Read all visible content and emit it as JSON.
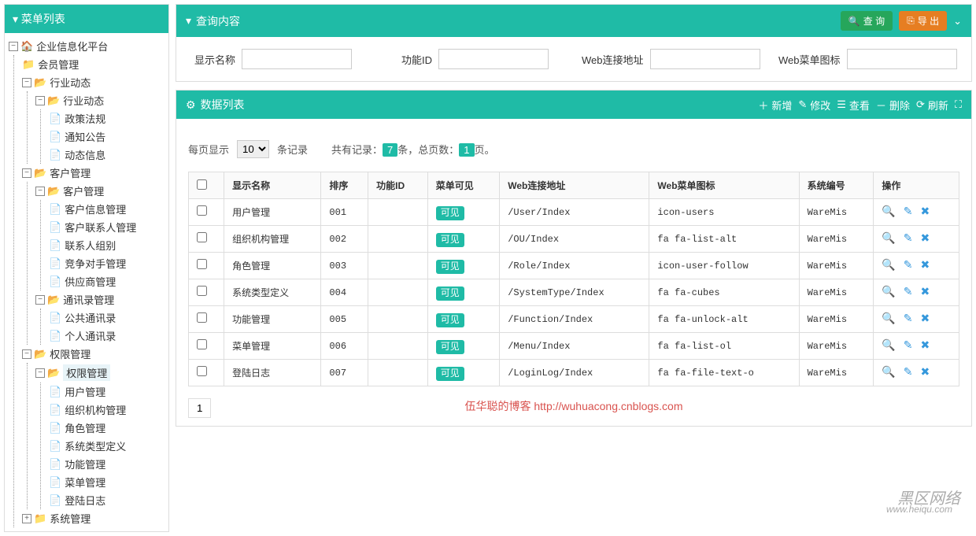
{
  "sidebar": {
    "title": "菜单列表",
    "tree": {
      "root": "企业信息化平台",
      "n0": "会员管理",
      "n1": "行业动态",
      "n1_0": "行业动态",
      "n1_0_0": "政策法规",
      "n1_0_1": "通知公告",
      "n1_0_2": "动态信息",
      "n2": "客户管理",
      "n2_0": "客户管理",
      "n2_0_0": "客户信息管理",
      "n2_0_1": "客户联系人管理",
      "n2_0_2": "联系人组别",
      "n2_0_3": "竞争对手管理",
      "n2_0_4": "供应商管理",
      "n2_1": "通讯录管理",
      "n2_1_0": "公共通讯录",
      "n2_1_1": "个人通讯录",
      "n3": "权限管理",
      "n3_0": "权限管理",
      "n3_0_0": "用户管理",
      "n3_0_1": "组织机构管理",
      "n3_0_2": "角色管理",
      "n3_0_3": "系统类型定义",
      "n3_0_4": "功能管理",
      "n3_0_5": "菜单管理",
      "n3_0_6": "登陆日志",
      "n4": "系统管理"
    }
  },
  "query": {
    "title": "查询内容",
    "search_btn": "查 询",
    "export_btn": "导 出",
    "f1": "显示名称",
    "f2": "功能ID",
    "f3": "Web连接地址",
    "f4": "Web菜单图标"
  },
  "datalist": {
    "title": "数据列表",
    "add": "新增",
    "edit": "修改",
    "view": "查看",
    "delete": "删除",
    "refresh": "刷新",
    "per_page_pre": "每页显示",
    "per_page_val": "10",
    "per_page_post": "条记录",
    "total_pre": "共有记录：",
    "total_count": "7",
    "total_mid": "条，总页数：",
    "total_pages": "1",
    "total_post": "页。",
    "cols": {
      "c1": "显示名称",
      "c2": "排序",
      "c3": "功能ID",
      "c4": "菜单可见",
      "c5": "Web连接地址",
      "c6": "Web菜单图标",
      "c7": "系统编号",
      "c8": "操作"
    },
    "rows": [
      {
        "name": "用户管理",
        "order": "001",
        "visible": "可见",
        "url": "/User/Index",
        "icon": "icon-users",
        "sys": "WareMis"
      },
      {
        "name": "组织机构管理",
        "order": "002",
        "visible": "可见",
        "url": "/OU/Index",
        "icon": "fa fa-list-alt",
        "sys": "WareMis"
      },
      {
        "name": "角色管理",
        "order": "003",
        "visible": "可见",
        "url": "/Role/Index",
        "icon": "icon-user-follow",
        "sys": "WareMis"
      },
      {
        "name": "系统类型定义",
        "order": "004",
        "visible": "可见",
        "url": "/SystemType/Index",
        "icon": "fa fa-cubes",
        "sys": "WareMis"
      },
      {
        "name": "功能管理",
        "order": "005",
        "visible": "可见",
        "url": "/Function/Index",
        "icon": "fa fa-unlock-alt",
        "sys": "WareMis"
      },
      {
        "name": "菜单管理",
        "order": "006",
        "visible": "可见",
        "url": "/Menu/Index",
        "icon": "fa fa-list-ol",
        "sys": "WareMis"
      },
      {
        "name": "登陆日志",
        "order": "007",
        "visible": "可见",
        "url": "/LoginLog/Index",
        "icon": "fa fa-file-text-o",
        "sys": "WareMis"
      }
    ],
    "page1": "1"
  },
  "footer": "伍华聪的博客 http://wuhuacong.cnblogs.com",
  "watermark": "黑区网络",
  "watermark2": "www.heiqu.com"
}
